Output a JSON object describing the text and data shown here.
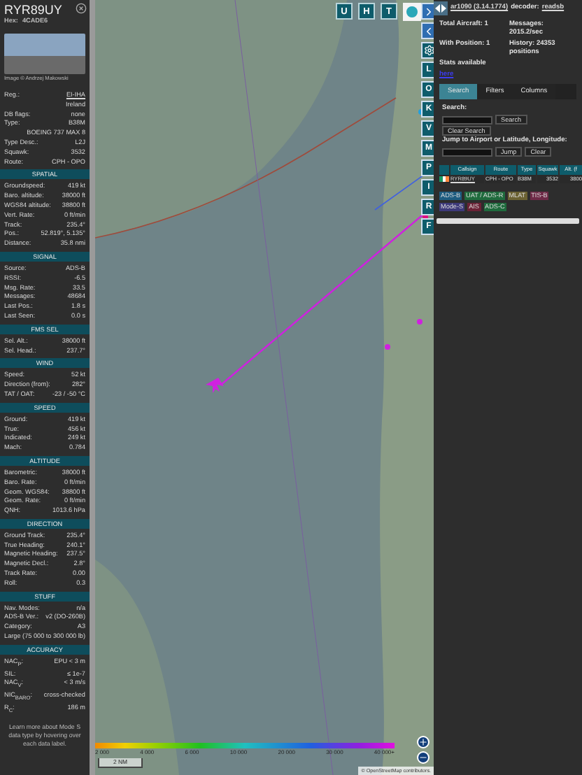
{
  "sidebar": {
    "callsign": "RYR89UY",
    "hex_label": "Hex:",
    "hex": "4CADE6",
    "photo_credit": "Image © Andrzej Makowski",
    "rows": [
      {
        "kind": "link",
        "label": "Reg.:",
        "value": "EI-IHA"
      },
      {
        "kind": "value",
        "value": "Ireland"
      },
      {
        "kind": "pair",
        "label": "DB flags:",
        "value": "none"
      },
      {
        "kind": "pair",
        "label": "Type:",
        "value": "B38M"
      },
      {
        "kind": "value",
        "value": "BOEING 737 MAX 8"
      },
      {
        "kind": "pair",
        "label": "Type Desc.:",
        "value": "L2J"
      },
      {
        "kind": "pair",
        "label": "Squawk:",
        "value": "3532"
      },
      {
        "kind": "pair",
        "label": "Route:",
        "value": "CPH - OPO"
      }
    ],
    "sections": [
      {
        "title": "SPATIAL",
        "rows": [
          {
            "kind": "pair",
            "label": "Groundspeed:",
            "value": "419 kt"
          },
          {
            "kind": "pair",
            "label": "Baro. altitude:",
            "value": "38000 ft"
          },
          {
            "kind": "pair",
            "label": "WGS84 altitude:",
            "value": "38800 ft"
          },
          {
            "kind": "pair",
            "label": "Vert. Rate:",
            "value": "0 ft/min"
          },
          {
            "kind": "pair",
            "label": "Track:",
            "value": "235.4°"
          },
          {
            "kind": "pair",
            "label": "Pos.:",
            "value": "52.819°, 5.135°"
          },
          {
            "kind": "pair",
            "label": "Distance:",
            "value": "35.8 nmi"
          }
        ]
      },
      {
        "title": "SIGNAL",
        "rows": [
          {
            "kind": "pair",
            "label": "Source:",
            "value": "ADS-B"
          },
          {
            "kind": "pair",
            "label": "RSSI:",
            "value": "-6.5"
          },
          {
            "kind": "pair",
            "label": "Msg. Rate:",
            "value": "33.5"
          },
          {
            "kind": "pair",
            "label": "Messages:",
            "value": "48684"
          },
          {
            "kind": "pair",
            "label": "Last Pos.:",
            "value": "1.8 s"
          },
          {
            "kind": "pair",
            "label": "Last Seen:",
            "value": "0.0 s"
          }
        ]
      },
      {
        "title": "FMS SEL",
        "rows": [
          {
            "kind": "pair",
            "label": "Sel. Alt.:",
            "value": "38000 ft"
          },
          {
            "kind": "pair",
            "label": "Sel. Head.:",
            "value": "237.7°"
          }
        ]
      },
      {
        "title": "WIND",
        "rows": [
          {
            "kind": "pair",
            "label": "Speed:",
            "value": "52 kt"
          },
          {
            "kind": "pair",
            "label": "Direction (from):",
            "value": "282°"
          },
          {
            "kind": "pair",
            "label": "TAT / OAT:",
            "value": "-23 / -50 °C"
          }
        ]
      },
      {
        "title": "SPEED",
        "rows": [
          {
            "kind": "pair",
            "label": "Ground:",
            "value": "419 kt"
          },
          {
            "kind": "pair",
            "label": "True:",
            "value": "456 kt"
          },
          {
            "kind": "pair",
            "label": "Indicated:",
            "value": "249 kt"
          },
          {
            "kind": "pair",
            "label": "Mach:",
            "value": "0.784"
          }
        ]
      },
      {
        "title": "ALTITUDE",
        "rows": [
          {
            "kind": "pair",
            "label": "Barometric:",
            "value": "38000 ft"
          },
          {
            "kind": "pair",
            "label": "Baro. Rate:",
            "value": "0 ft/min"
          },
          {
            "kind": "pair",
            "label": "Geom. WGS84:",
            "value": "38800 ft"
          },
          {
            "kind": "pair",
            "label": "Geom. Rate:",
            "value": "0 ft/min"
          },
          {
            "kind": "pair",
            "label": "QNH:",
            "value": "1013.6 hPa"
          }
        ]
      },
      {
        "title": "DIRECTION",
        "rows": [
          {
            "kind": "pair",
            "label": "Ground Track:",
            "value": "235.4°"
          },
          {
            "kind": "pair",
            "label": "True Heading:",
            "value": "240.1°"
          },
          {
            "kind": "pair",
            "label": "Magnetic Heading:",
            "value": "237.5°"
          },
          {
            "kind": "pair",
            "label": "Magnetic Decl.:",
            "value": "2.8°"
          },
          {
            "kind": "pair",
            "label": "Track Rate:",
            "value": "0.00"
          },
          {
            "kind": "pair",
            "label": "Roll:",
            "value": "0.3"
          }
        ]
      },
      {
        "title": "STUFF",
        "rows": [
          {
            "kind": "pair",
            "label": "Nav. Modes:",
            "value": "n/a"
          },
          {
            "kind": "pair",
            "label": "ADS-B Ver.:",
            "value": "v2 (DO-260B)"
          },
          {
            "kind": "pair",
            "label": "Category:",
            "value": "A3"
          },
          {
            "kind": "value",
            "value": "Large (75 000 to 300 000 lb)"
          }
        ]
      },
      {
        "title": "ACCURACY",
        "rows": [
          {
            "kind": "pair",
            "label": "NAC$_{P}$:",
            "value": "EPU < 3 m"
          },
          {
            "kind": "pair",
            "label": "SIL:",
            "value": "≤ 1e-7"
          },
          {
            "kind": "pair",
            "label": "NAC$_{V}$:",
            "value": "< 3 m/s"
          },
          {
            "kind": "pair",
            "label": "NIC$_{BARO}$:",
            "value": "cross-checked"
          },
          {
            "kind": "pair",
            "label": "R$_{C}$:",
            "value": "186 m"
          }
        ]
      }
    ],
    "note": "Learn more about Mode S data type by hovering over each data label."
  },
  "map": {
    "top_buttons": [
      "U",
      "H",
      "T"
    ],
    "side_buttons": [
      {
        "kind": "next"
      },
      {
        "kind": "prev"
      },
      {
        "kind": "settings"
      },
      {
        "kind": "letter",
        "label": "L"
      },
      {
        "kind": "letter",
        "label": "O"
      },
      {
        "kind": "letter",
        "label": "K"
      },
      {
        "kind": "letter",
        "label": "V"
      },
      {
        "kind": "letter",
        "label": "M"
      },
      {
        "kind": "letter",
        "label": "P"
      },
      {
        "kind": "letter",
        "label": "I"
      },
      {
        "kind": "letter",
        "label": "R"
      },
      {
        "kind": "letter",
        "label": "F"
      }
    ],
    "legend": [
      "2 000",
      "4 000",
      "6 000",
      "10 000",
      "20 000",
      "30 000",
      "40 000+"
    ],
    "scale": "2 NM",
    "attribution": "© OpenStreetMap contributors."
  },
  "panel": {
    "app": "ar1090 (3.14.1774)",
    "decoder_label": "decoder:",
    "decoder": "readsb",
    "stats": [
      "Total Aircraft: 1",
      "Messages: 2015.2/sec",
      "With Position: 1",
      "History: 24353 positions"
    ],
    "stats_text": "Stats available",
    "stats_link": "here",
    "tabs": [
      {
        "label": "Search",
        "selected": true
      },
      {
        "label": "Filters",
        "selected": false
      },
      {
        "label": "Columns",
        "selected": false
      }
    ],
    "search_label": "Search:",
    "search_button": "Search",
    "clear_button": "Clear Search",
    "jump_label": "Jump to Airport or Latitude, Longitude:",
    "jump_button": "Jump",
    "jump_clear": "Clear",
    "table": {
      "columns": [
        "Callsign",
        "Route",
        "Type",
        "Squawk",
        "Alt. (f"
      ],
      "rows": [
        {
          "cells": [
            "RYR89UY",
            "CPH - OPO",
            "B38M",
            "3532",
            "3800"
          ]
        }
      ]
    },
    "tags": [
      {
        "label": "ADS-B",
        "color": "#1d5c80"
      },
      {
        "label": "UAT / ADS-R",
        "color": "#1f6b3d"
      },
      {
        "label": "MLAT",
        "color": "#6b6233"
      },
      {
        "label": "TIS-B",
        "color": "#6e2a47"
      },
      {
        "label": "Mode-S",
        "color": "#3d3a7a"
      },
      {
        "label": "AIS",
        "color": "#6b2236"
      },
      {
        "label": "ADS-C",
        "color": "#1f6b3d"
      }
    ]
  }
}
